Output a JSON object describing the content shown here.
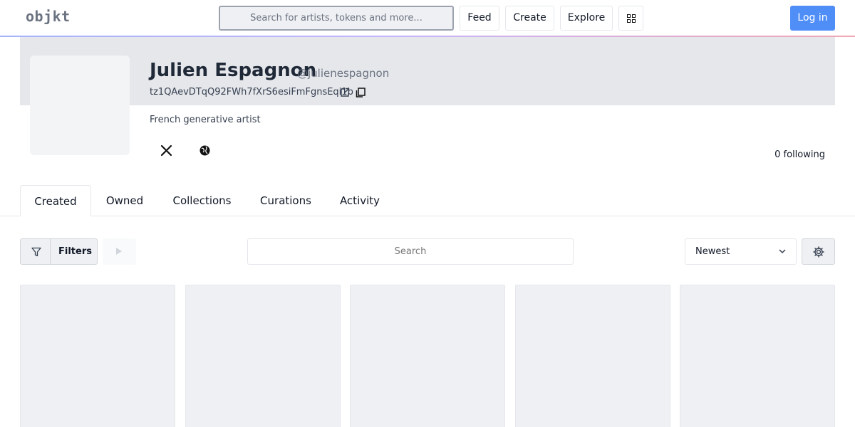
{
  "header": {
    "logo": "objkt",
    "search_placeholder": "Search for artists, tokens and more...",
    "nav": {
      "feed": "Feed",
      "create": "Create",
      "explore": "Explore"
    },
    "login": "Log in"
  },
  "profile": {
    "name": "Julien Espagnon",
    "handle": "@julienespagnon",
    "address": "tz1QAevDTqQ92FWh7fXrS6esiFmFgnsEqi1b",
    "bio": "French generative artist",
    "following": "0 following",
    "social": [
      "x-icon",
      "globe-icon"
    ]
  },
  "tabs": [
    {
      "label": "Created",
      "active": true
    },
    {
      "label": "Owned",
      "active": false
    },
    {
      "label": "Collections",
      "active": false
    },
    {
      "label": "Curations",
      "active": false
    },
    {
      "label": "Activity",
      "active": false
    }
  ],
  "toolbar": {
    "filters_label": "Filters",
    "search_placeholder": "Search",
    "sort_value": "Newest"
  },
  "colors": {
    "accent": "#4f8ef7",
    "banner": "#e5e7eb",
    "card_placeholder": "#eef0f3"
  }
}
